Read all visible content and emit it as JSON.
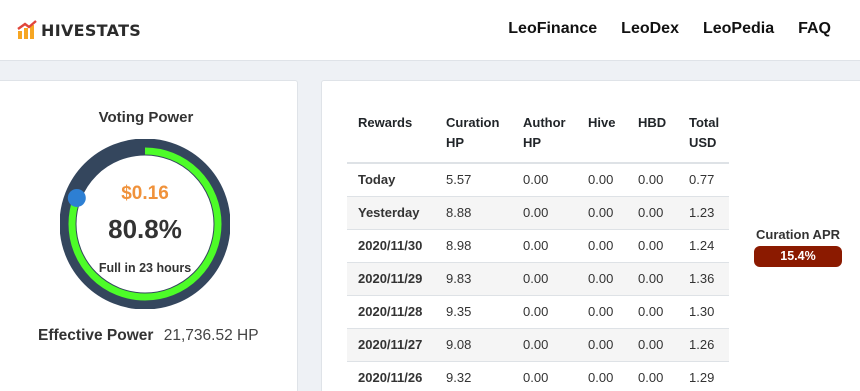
{
  "brand": {
    "name": "HIVESTATS",
    "logo_icon": "chart-logo-icon"
  },
  "nav": {
    "links": [
      "LeoFinance",
      "LeoDex",
      "LeoPedia",
      "FAQ"
    ]
  },
  "voting": {
    "title": "Voting Power",
    "dollar_value": "$0.16",
    "percent_text": "80.8%",
    "percent_value": 0.808,
    "full_in": "Full in 23 hours",
    "effective_label": "Effective Power",
    "effective_value": "21,736.52 HP",
    "colors": {
      "track": "#34465d",
      "fill": "#4dfc28",
      "knob": "#2d7fd3",
      "dollars": "#f0923b"
    }
  },
  "rewards": {
    "headers": [
      [
        "Rewards"
      ],
      [
        "Curation",
        "HP"
      ],
      [
        "Author",
        "HP"
      ],
      [
        "Hive"
      ],
      [
        "HBD"
      ],
      [
        "Total",
        "USD"
      ]
    ],
    "rows": [
      [
        "Today",
        "5.57",
        "0.00",
        "0.00",
        "0.00",
        "0.77"
      ],
      [
        "Yesterday",
        "8.88",
        "0.00",
        "0.00",
        "0.00",
        "1.23"
      ],
      [
        "2020/11/30",
        "8.98",
        "0.00",
        "0.00",
        "0.00",
        "1.24"
      ],
      [
        "2020/11/29",
        "9.83",
        "0.00",
        "0.00",
        "0.00",
        "1.36"
      ],
      [
        "2020/11/28",
        "9.35",
        "0.00",
        "0.00",
        "0.00",
        "1.30"
      ],
      [
        "2020/11/27",
        "9.08",
        "0.00",
        "0.00",
        "0.00",
        "1.26"
      ],
      [
        "2020/11/26",
        "9.32",
        "0.00",
        "0.00",
        "0.00",
        "1.29"
      ]
    ]
  },
  "apr": {
    "label": "Curation APR",
    "value": "15.4%",
    "color": "#8b1a00"
  }
}
